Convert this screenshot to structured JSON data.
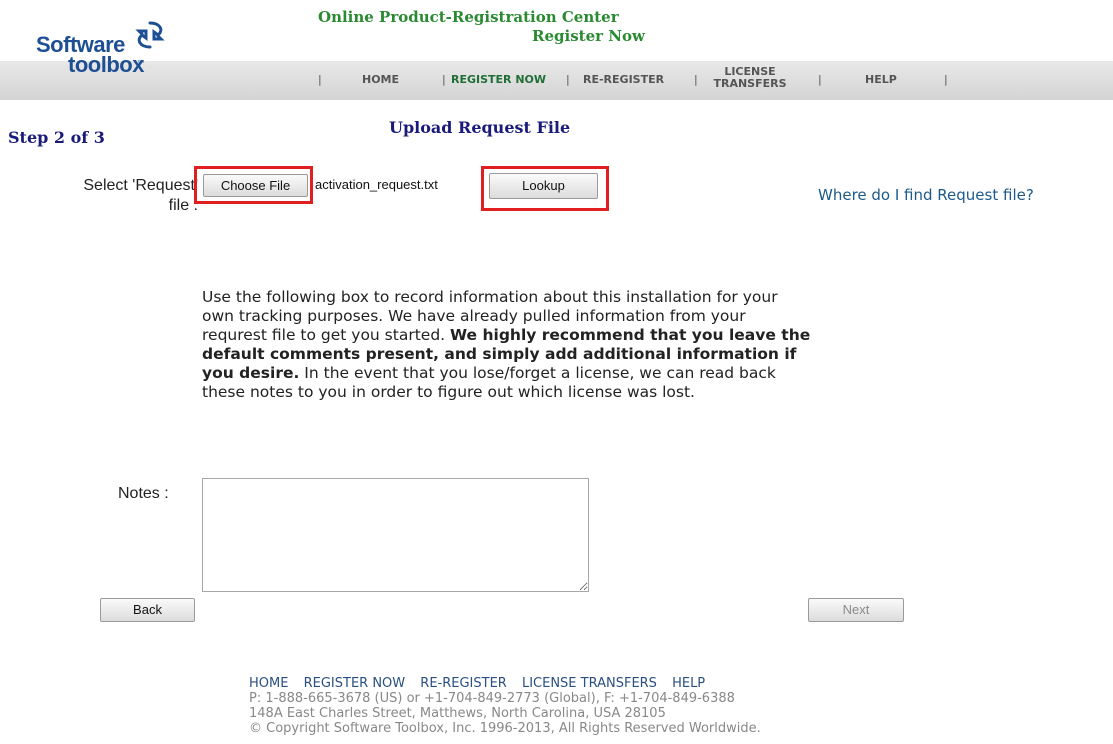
{
  "header": {
    "logo_software": "Software",
    "logo_toolbox": "toolbox",
    "logo_tm": "™",
    "title": "Online Product-Registration Center",
    "subtitle": "Register Now"
  },
  "nav": {
    "sep": "|",
    "home": "HOME",
    "register_now": "REGISTER NOW",
    "re_register": "RE-REGISTER",
    "license": "LICENSE",
    "transfers": "TRANSFERS",
    "help": "HELP"
  },
  "step": "Step 2 of 3",
  "page_title": "Upload Request File",
  "form": {
    "select_label_1": "Select 'Request'",
    "select_label_2": "file :",
    "choose_file": "Choose File",
    "filename": "activation_request.txt",
    "lookup": "Lookup",
    "find_link": "Where do I find Request file?",
    "info_1": "Use the following box to record information about this installation for your own tracking purposes. We have already pulled information from your requrest file to get you started. ",
    "info_bold": "We highly recommend that you leave the default comments present, and simply add additional information if you desire.",
    "info_2": " In the event that you lose/forget a license, we can read back these notes to you in order to figure out which license was lost.",
    "notes_label": "Notes :",
    "notes_value": "",
    "back": "Back",
    "next": "Next"
  },
  "footer": {
    "links": [
      "HOME",
      "REGISTER NOW",
      "RE-REGISTER",
      "LICENSE TRANSFERS",
      "HELP"
    ],
    "phone": "P: 1-888-665-3678 (US) or +1-704-849-2773 (Global), F: +1-704-849-6388",
    "address": "148A East Charles Street, Matthews, North Carolina, USA 28105",
    "copyright": "© Copyright Software Toolbox, Inc. 1996-2013, All Rights Reserved Worldwide."
  },
  "colors": {
    "brand_blue": "#1e4f93",
    "title_green": "#2a8a32",
    "heading_navy": "#1a1a7a",
    "highlight_red": "#e02020",
    "link_blue": "#1d5a8a"
  }
}
